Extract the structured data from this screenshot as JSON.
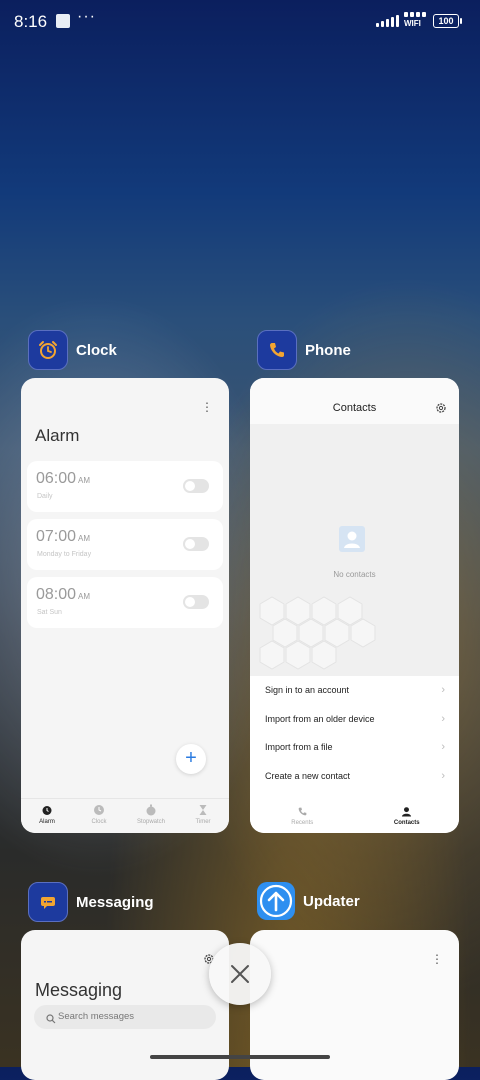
{
  "status_bar": {
    "time": "8:16",
    "dots": "···",
    "wifi_label": "WIFI",
    "battery": "100"
  },
  "apps": [
    {
      "name": "Clock",
      "icon": "alarm-clock-icon",
      "screen": {
        "title": "Alarm",
        "alarms": [
          {
            "time": "06:00",
            "ampm": "AM",
            "repeat": "Daily",
            "enabled": false
          },
          {
            "time": "07:00",
            "ampm": "AM",
            "repeat": "Monday to Friday",
            "enabled": false
          },
          {
            "time": "08:00",
            "ampm": "AM",
            "repeat": "Sat Sun",
            "enabled": false
          }
        ],
        "tabs": [
          "Alarm",
          "Clock",
          "Stopwatch",
          "Timer"
        ],
        "active_tab": "Alarm"
      }
    },
    {
      "name": "Phone",
      "icon": "phone-icon",
      "screen": {
        "title": "Contacts",
        "empty_text": "No contacts",
        "menu": [
          "Sign in to an account",
          "Import from an older device",
          "Import from a file",
          "Create a new contact"
        ],
        "tabs": [
          "Recents",
          "Contacts"
        ],
        "active_tab": "Contacts"
      }
    },
    {
      "name": "Messaging",
      "icon": "message-bubble-icon",
      "screen": {
        "title": "Messaging",
        "search_placeholder": "Search messages"
      }
    },
    {
      "name": "Updater",
      "icon": "arrow-up-icon",
      "screen": {}
    }
  ],
  "colors": {
    "clock_icon_bg": "#1d3a9e",
    "clock_icon_fg": "#f3a531",
    "phone_icon_bg": "#1d3a9e",
    "phone_icon_fg": "#f3a531",
    "messaging_icon_bg": "#1d3a9e",
    "updater_icon_bg": "#2e8ff0",
    "fab_accent": "#2b7be0"
  }
}
